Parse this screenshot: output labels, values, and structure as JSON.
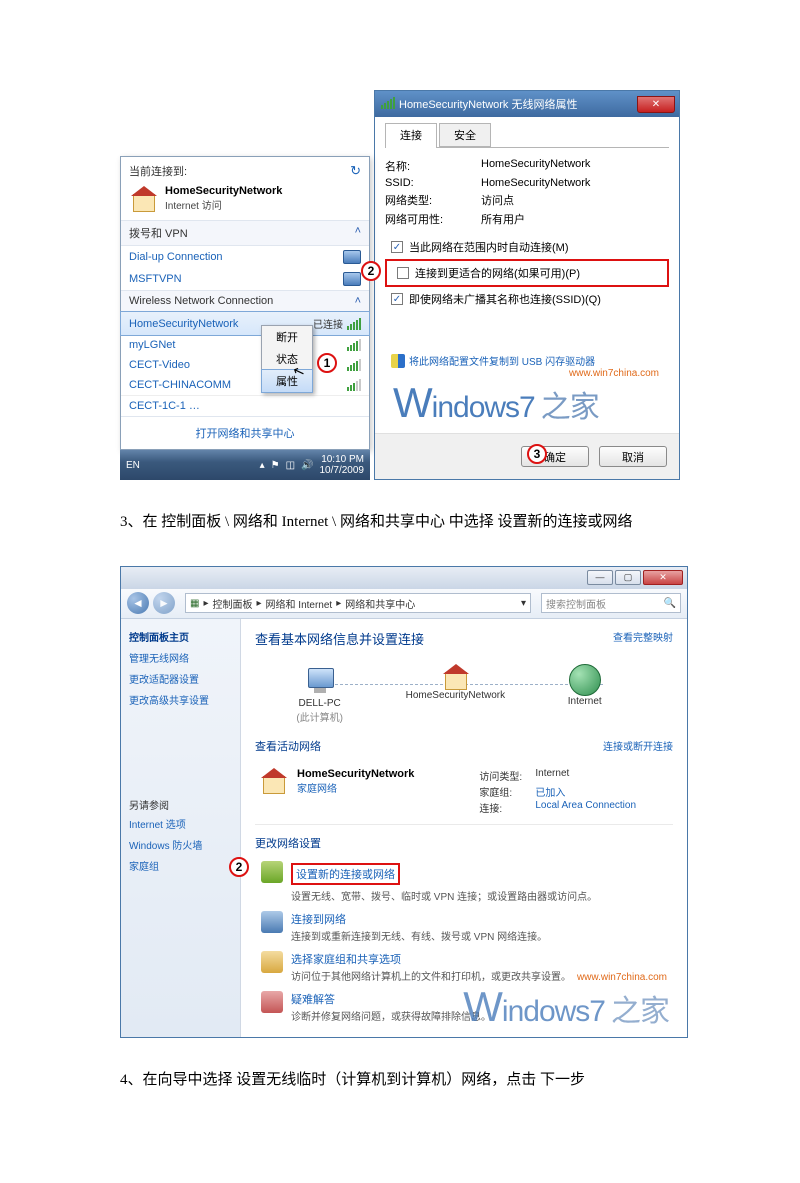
{
  "flyout": {
    "header": "当前连接到:",
    "network_name": "HomeSecurityNetwork",
    "network_sub": "Internet 访问",
    "sec_dialup": "拨号和 VPN",
    "items_dialup": [
      "Dial-up Connection",
      "MSFTVPN"
    ],
    "sec_wireless": "Wireless Network Connection",
    "wifi": [
      {
        "name": "HomeSecurityNetwork",
        "status": "已连接",
        "bars": 5
      },
      {
        "name": "myLGNet",
        "bars": 4
      },
      {
        "name": "CECT-Video",
        "bars": 4
      },
      {
        "name": "CECT-CHINACOMM",
        "bars": 3
      }
    ],
    "context": [
      "断开",
      "状态",
      "属性"
    ],
    "footer": "打开网络和共享中心",
    "taskbar": {
      "lang": "EN",
      "time": "10:10 PM",
      "date": "10/7/2009"
    }
  },
  "dialog": {
    "title": "HomeSecurityNetwork 无线网络属性",
    "tabs": [
      "连接",
      "安全"
    ],
    "fields": {
      "name_lbl": "名称:",
      "name_val": "HomeSecurityNetwork",
      "ssid_lbl": "SSID:",
      "ssid_val": "HomeSecurityNetwork",
      "type_lbl": "网络类型:",
      "type_val": "访问点",
      "usr_lbl": "网络可用性:",
      "usr_val": "所有用户"
    },
    "checks": {
      "c1": "当此网络在范围内时自动连接(M)",
      "c2": "连接到更适合的网络(如果可用)(P)",
      "c3": "即使网络未广播其名称也连接(SSID)(Q)"
    },
    "link": "将此网络配置文件复制到 USB 闪存驱动器",
    "ok": "确定",
    "cancel": "取消",
    "wm": {
      "w": "W",
      "rest": "indows7",
      "cn": "之家",
      "url": "www.win7china.com"
    }
  },
  "step3": "3、在 控制面板 \\ 网络和 Internet \\ 网络和共享中心 中选择 设置新的连接或网络",
  "step4": "4、在向导中选择 设置无线临时（计算机到计算机）网络，点击 下一步",
  "cp": {
    "crumb": [
      "控制面板",
      "网络和 Internet",
      "网络和共享中心"
    ],
    "search_ph": "搜索控制面板",
    "side_head": "控制面板主页",
    "side": [
      "管理无线网络",
      "更改适配器设置",
      "更改高级共享设置"
    ],
    "seealso_head": "另请参阅",
    "seealso": [
      "Internet 选项",
      "Windows 防火墙",
      "家庭组"
    ],
    "h": "查看基本网络信息并设置连接",
    "fullmap": "查看完整映射",
    "nodes": {
      "pc": "DELL-PC",
      "pc_sub": "(此计算机)",
      "mid": "HomeSecurityNetwork",
      "net": "Internet"
    },
    "active_head": "查看活动网络",
    "active_link": "连接或断开连接",
    "active": {
      "name": "HomeSecurityNetwork",
      "sub": "家庭网络",
      "m": [
        {
          "l": "访问类型:",
          "v": "Internet",
          "link": false
        },
        {
          "l": "家庭组:",
          "v": "已加入",
          "link": true
        },
        {
          "l": "连接:",
          "v": "Local Area Connection",
          "link": true
        }
      ]
    },
    "change_head": "更改网络设置",
    "tasks": [
      {
        "t": "设置新的连接或网络",
        "d": "设置无线、宽带、拨号、临时或 VPN 连接；或设置路由器或访问点。",
        "hl": true
      },
      {
        "t": "连接到网络",
        "d": "连接到或重新连接到无线、有线、拨号或 VPN 网络连接。"
      },
      {
        "t": "选择家庭组和共享选项",
        "d": "访问位于其他网络计算机上的文件和打印机，或更改共享设置。"
      },
      {
        "t": "疑难解答",
        "d": "诊断并修复网络问题，或获得故障排除信息。"
      }
    ]
  }
}
